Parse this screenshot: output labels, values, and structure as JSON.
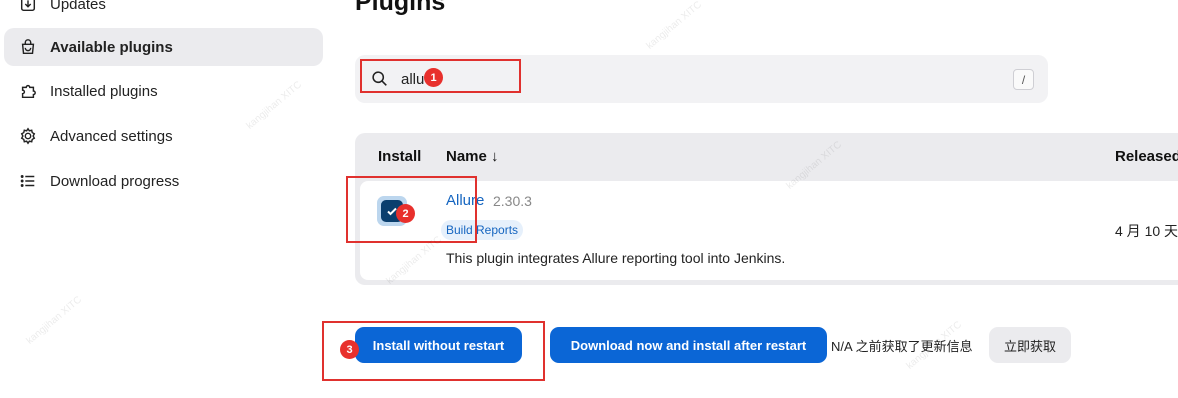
{
  "sidebar": {
    "items": [
      {
        "label": "Updates",
        "icon": "download-icon"
      },
      {
        "label": "Available plugins",
        "icon": "shopping-bag-icon",
        "active": true
      },
      {
        "label": "Installed plugins",
        "icon": "puzzle-icon"
      },
      {
        "label": "Advanced settings",
        "icon": "gear-icon"
      },
      {
        "label": "Download progress",
        "icon": "list-icon"
      }
    ]
  },
  "page": {
    "title": "Plugins"
  },
  "search": {
    "value": "allu",
    "shortcut": "/"
  },
  "table": {
    "columns": {
      "install": "Install",
      "name": "Name ↓",
      "released": "Released"
    },
    "rows": [
      {
        "name": "Allure",
        "version": "2.30.3",
        "tag": "Build Reports",
        "description": "This plugin integrates Allure reporting tool into Jenkins.",
        "released": "4 月 10 天",
        "checked": true
      }
    ]
  },
  "actions": {
    "install_without_restart": "Install without restart",
    "download_install_after_restart": "Download now and install after restart",
    "status": "N/A 之前获取了更新信息",
    "fetch_now": "立即获取"
  },
  "annotations": {
    "badge1": "1",
    "badge2": "2",
    "badge3": "3"
  },
  "watermark": "kangjihan XITC",
  "colors": {
    "primary": "#0b66d6",
    "annotation": "#e0312e",
    "link": "#1565c0"
  }
}
